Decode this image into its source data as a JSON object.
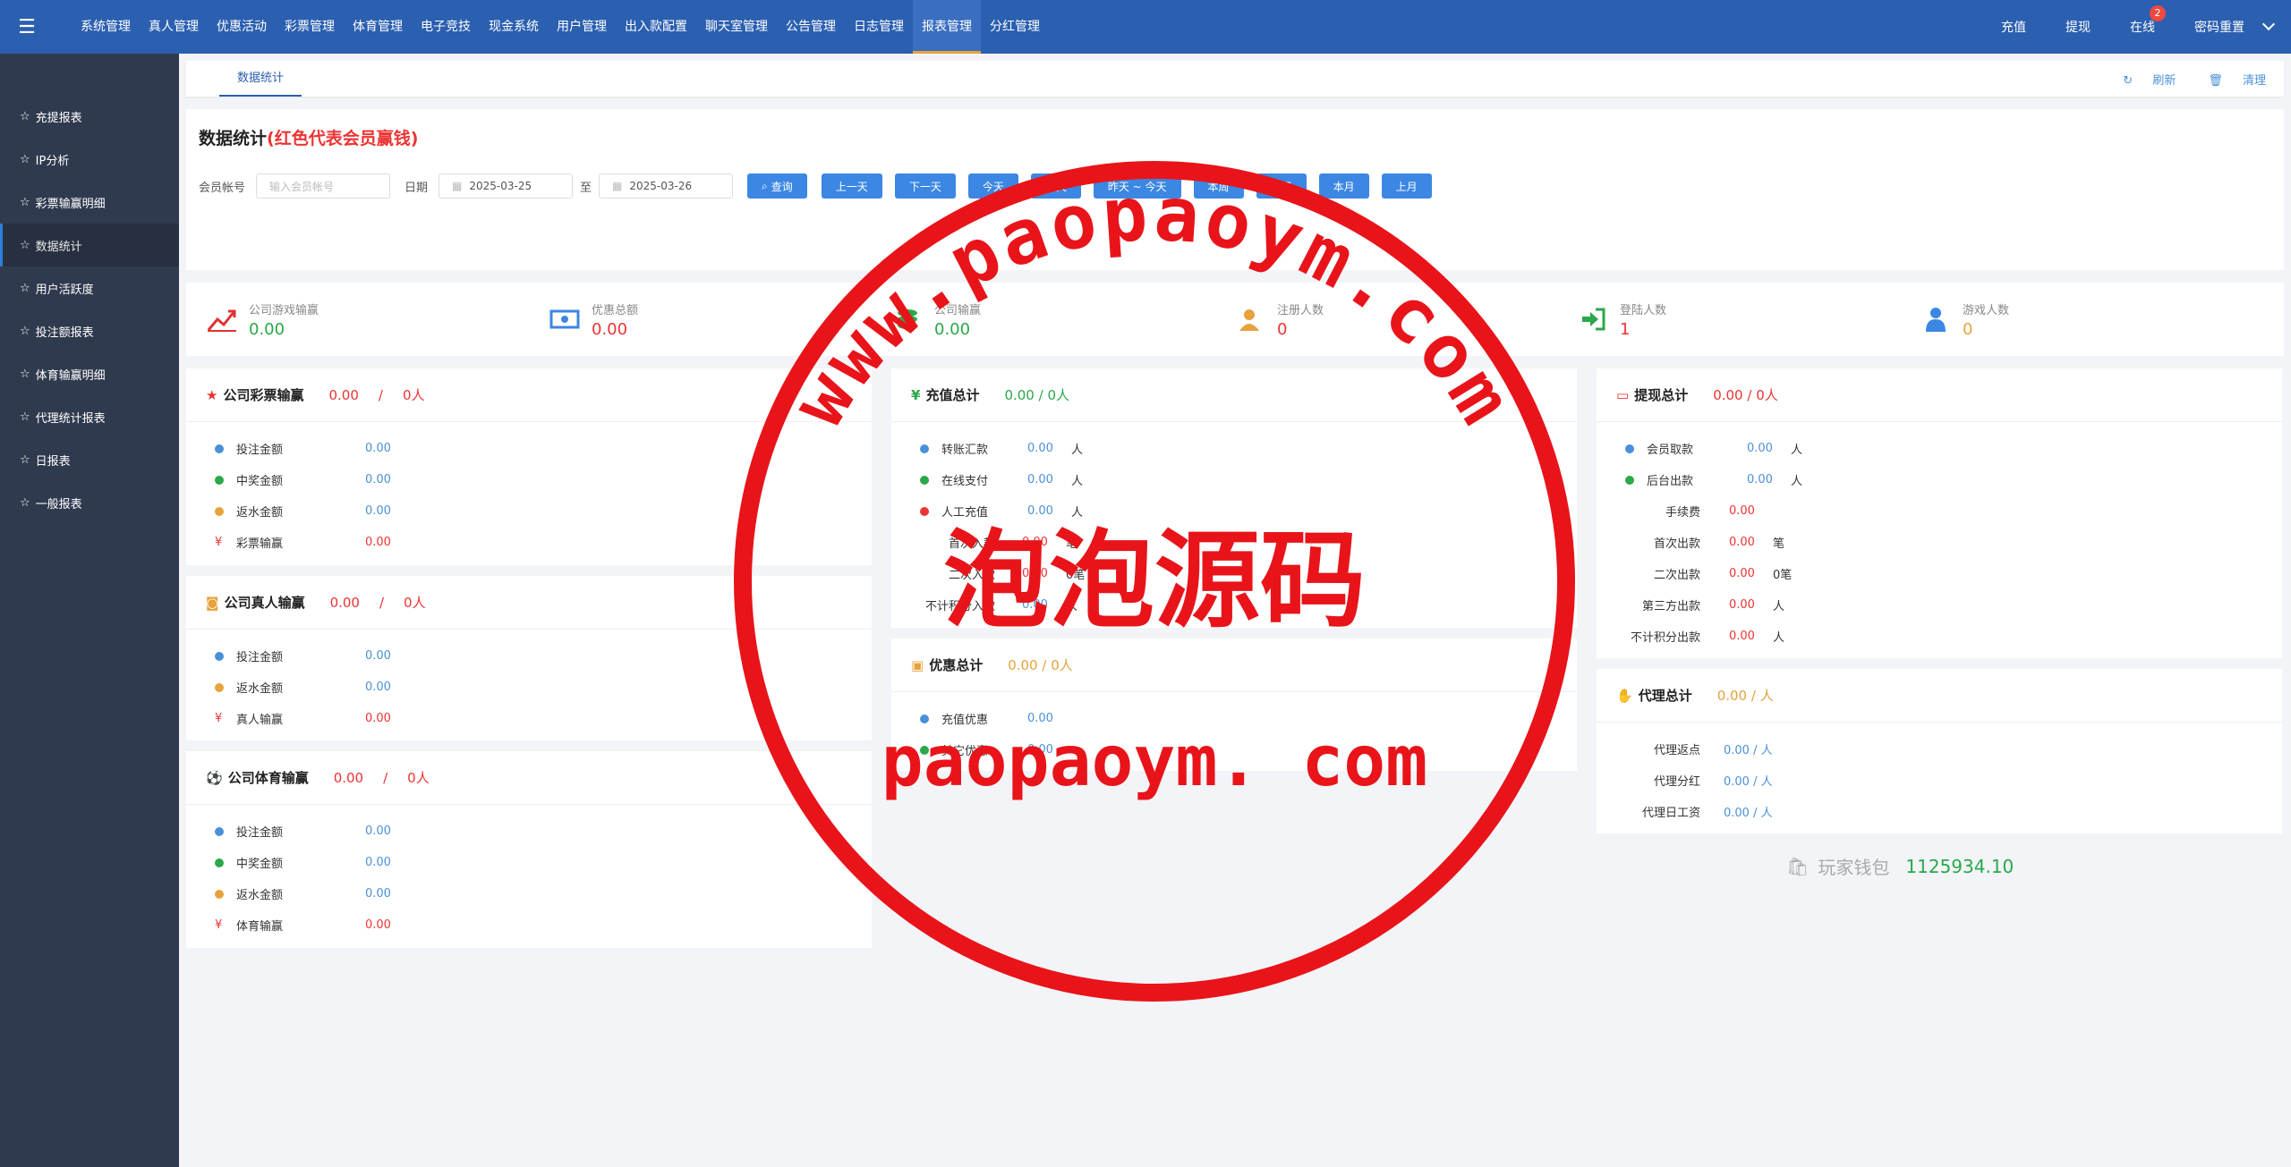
{
  "topnav": {
    "items": [
      "系统管理",
      "真人管理",
      "优惠活动",
      "彩票管理",
      "体育管理",
      "电子竞技",
      "现金系统",
      "用户管理",
      "出入款配置",
      "聊天室管理",
      "公告管理",
      "日志管理",
      "报表管理",
      "分红管理"
    ],
    "right": [
      "充值",
      "提现",
      "在线",
      "密码重置"
    ],
    "online_badge": "2"
  },
  "sidebar": {
    "items": [
      "充提报表",
      "IP分析",
      "彩票输赢明细",
      "数据统计",
      "用户活跃度",
      "投注额报表",
      "体育输赢明细",
      "代理统计报表",
      "日报表",
      "一般报表"
    ]
  },
  "tabbar": {
    "tab": "数据统计",
    "refresh": "刷新",
    "clear": "清理"
  },
  "filter": {
    "title": "数据统计",
    "title_note": "(红色代表会员赢钱)",
    "member_label": "会员帐号",
    "member_placeholder": "输入会员帐号",
    "date_label": "日期",
    "date_from": "2025-03-25",
    "to_label": "至",
    "date_to": "2025-03-26",
    "search": "查询",
    "buttons": [
      "上一天",
      "下一天",
      "今天",
      "昨天",
      "昨天 ~ 今天",
      "本周",
      "上周",
      "本月",
      "上月"
    ]
  },
  "stats": [
    {
      "label": "公司游戏输赢",
      "value": "0.00",
      "color": "#2aa84a"
    },
    {
      "label": "优惠总额",
      "value": "0.00",
      "color": "#e33"
    },
    {
      "label": "公司输赢",
      "value": "0.00",
      "color": "#2aa84a"
    },
    {
      "label": "注册人数",
      "value": "0",
      "color": "#e33"
    },
    {
      "label": "登陆人数",
      "value": "1",
      "color": "#e33"
    },
    {
      "label": "游戏人数",
      "value": "0",
      "color": "#e6a23c"
    }
  ],
  "lottery": {
    "title": "公司彩票输赢",
    "amount": "0.00",
    "sep": "/",
    "people": "0人",
    "rows": [
      {
        "label": "投注金额",
        "value": "0.00"
      },
      {
        "label": "中奖金额",
        "value": "0.00"
      },
      {
        "label": "返水金额",
        "value": "0.00"
      },
      {
        "label": "彩票输赢",
        "value": "0.00"
      }
    ]
  },
  "live": {
    "title": "公司真人输赢",
    "amount": "0.00",
    "sep": "/",
    "people": "0人",
    "rows": [
      {
        "label": "投注金额",
        "value": "0.00"
      },
      {
        "label": "返水金额",
        "value": "0.00"
      },
      {
        "label": "真人输赢",
        "value": "0.00"
      }
    ]
  },
  "sports": {
    "title": "公司体育输赢",
    "amount": "0.00",
    "sep": "/",
    "people": "0人",
    "rows": [
      {
        "label": "投注金额",
        "value": "0.00"
      },
      {
        "label": "中奖金额",
        "value": "0.00"
      },
      {
        "label": "返水金额",
        "value": "0.00"
      },
      {
        "label": "体育输赢",
        "value": "0.00"
      }
    ]
  },
  "deposit": {
    "title": "充值总计",
    "summary": "0.00 / 0人",
    "rows": [
      {
        "label": "转账汇款",
        "value": "0.00",
        "unit": "人"
      },
      {
        "label": "在线支付",
        "value": "0.00",
        "unit": "人"
      },
      {
        "label": "人工充值",
        "value": "0.00",
        "unit": "人"
      },
      {
        "label": "首次入款",
        "value": "0.00",
        "unit": "笔"
      },
      {
        "label": "二次入款",
        "value": "0.00",
        "unit": "0笔"
      },
      {
        "label": "不计积分入款",
        "value": "0.00",
        "unit": "人"
      }
    ]
  },
  "promo": {
    "title": "优惠总计",
    "summary": "0.00 / 0人",
    "rows": [
      {
        "label": "充值优惠",
        "value": "0.00"
      },
      {
        "label": "其它优惠",
        "value": "0.00"
      }
    ]
  },
  "withdraw": {
    "title": "提现总计",
    "summary": "0.00 / 0人",
    "rows": [
      {
        "label": "会员取款",
        "value": "0.00",
        "unit": "人"
      },
      {
        "label": "后台出款",
        "value": "0.00",
        "unit": "人"
      },
      {
        "label": "手续费",
        "value": "0.00",
        "unit": ""
      },
      {
        "label": "首次出款",
        "value": "0.00",
        "unit": "笔"
      },
      {
        "label": "二次出款",
        "value": "0.00",
        "unit": "0笔"
      },
      {
        "label": "第三方出款",
        "value": "0.00",
        "unit": "人"
      },
      {
        "label": "不计积分出款",
        "value": "0.00",
        "unit": "人"
      }
    ]
  },
  "agent": {
    "title": "代理总计",
    "summary": "0.00 / 人",
    "rows": [
      {
        "label": "代理返点",
        "value": "0.00 / 人"
      },
      {
        "label": "代理分红",
        "value": "0.00 / 人"
      },
      {
        "label": "代理日工资",
        "value": "0.00 / 人"
      }
    ]
  },
  "wallet": {
    "label": "玩家钱包",
    "value": "1125934.10"
  },
  "watermark": {
    "arc_text": "www.paopaoym.com",
    "cn": "泡泡源码",
    "bottom": "paopaoym. com"
  },
  "colors": {
    "header": "#2b5fb0",
    "sidebar": "#303a4f",
    "button": "#3b87e3",
    "loss": "#e33",
    "gain": "#2aa84a"
  }
}
